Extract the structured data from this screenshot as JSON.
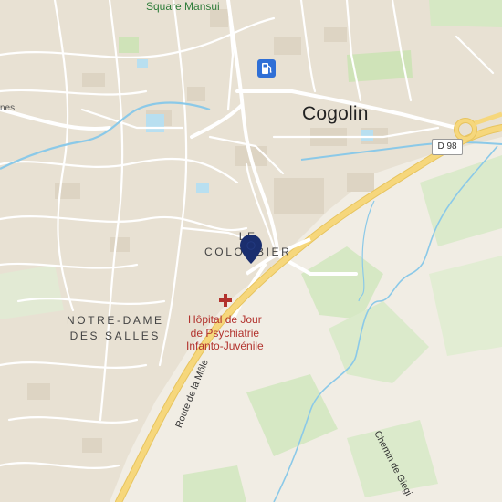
{
  "map": {
    "place_labels": {
      "town": "Cogolin",
      "square": "Square Mansui",
      "colombier_line1": "LE",
      "colombier_line2": "COLOMBIER",
      "notredame_line1": "NOTRE-DAME",
      "notredame_line2": "DES SALLES",
      "edge_fragment": "nes"
    },
    "poi": {
      "hospital_line1": "Hôpital de Jour",
      "hospital_line2": "de Psychiatrie",
      "hospital_line3": "Infanto-Juvénile"
    },
    "roads": {
      "d98_shield": "D 98",
      "route_mole": "Route de la Môle",
      "chemin_giegi": "Chemin de Giegi"
    },
    "icons": {
      "fuel": "fuel-station-icon",
      "hospital": "hospital-cross-icon",
      "location_pin": "location-pin-icon"
    },
    "colors": {
      "background": "#f1ede4",
      "urban": "#e8e1d3",
      "buildings": "#ddd4c3",
      "green": "#d6e8c4",
      "water": "#8bc9e8",
      "main_road": "#f6d77c",
      "pin": "#1a2e6e",
      "hospital": "#b2322d"
    }
  }
}
